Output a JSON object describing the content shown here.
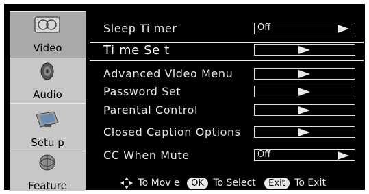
{
  "sidebar": {
    "tabs": [
      {
        "label": "Video",
        "icon": "video-icon"
      },
      {
        "label": "Audio",
        "icon": "audio-speaker-icon"
      },
      {
        "label": "Setu p",
        "icon": "setup-monitor-icon"
      },
      {
        "label": "Feature",
        "icon": "feature-globe-icon"
      }
    ],
    "selected": "Video"
  },
  "menu": {
    "items": [
      {
        "label": "Sleep  Ti mer",
        "value": "Off"
      },
      {
        "label": "Ti me  Se t",
        "value": ""
      },
      {
        "label": "Advanced  Video  Menu",
        "value": ""
      },
      {
        "label": "Password   Set",
        "value": ""
      },
      {
        "label": "Parental  Control",
        "value": ""
      },
      {
        "label": "Closed  Caption  Options",
        "value": ""
      },
      {
        "label": "CC  When  Mute",
        "value": "Off"
      }
    ],
    "selected_index": 1
  },
  "footer": {
    "move_text": "To Mov e",
    "ok_key": "OK",
    "select_text": "To Select",
    "exit_key": "Exit",
    "exit_text": "To Exit"
  },
  "colors": {
    "background": "#000000",
    "sidebar": "#c7c7c7",
    "text": "#e8e8e8"
  }
}
